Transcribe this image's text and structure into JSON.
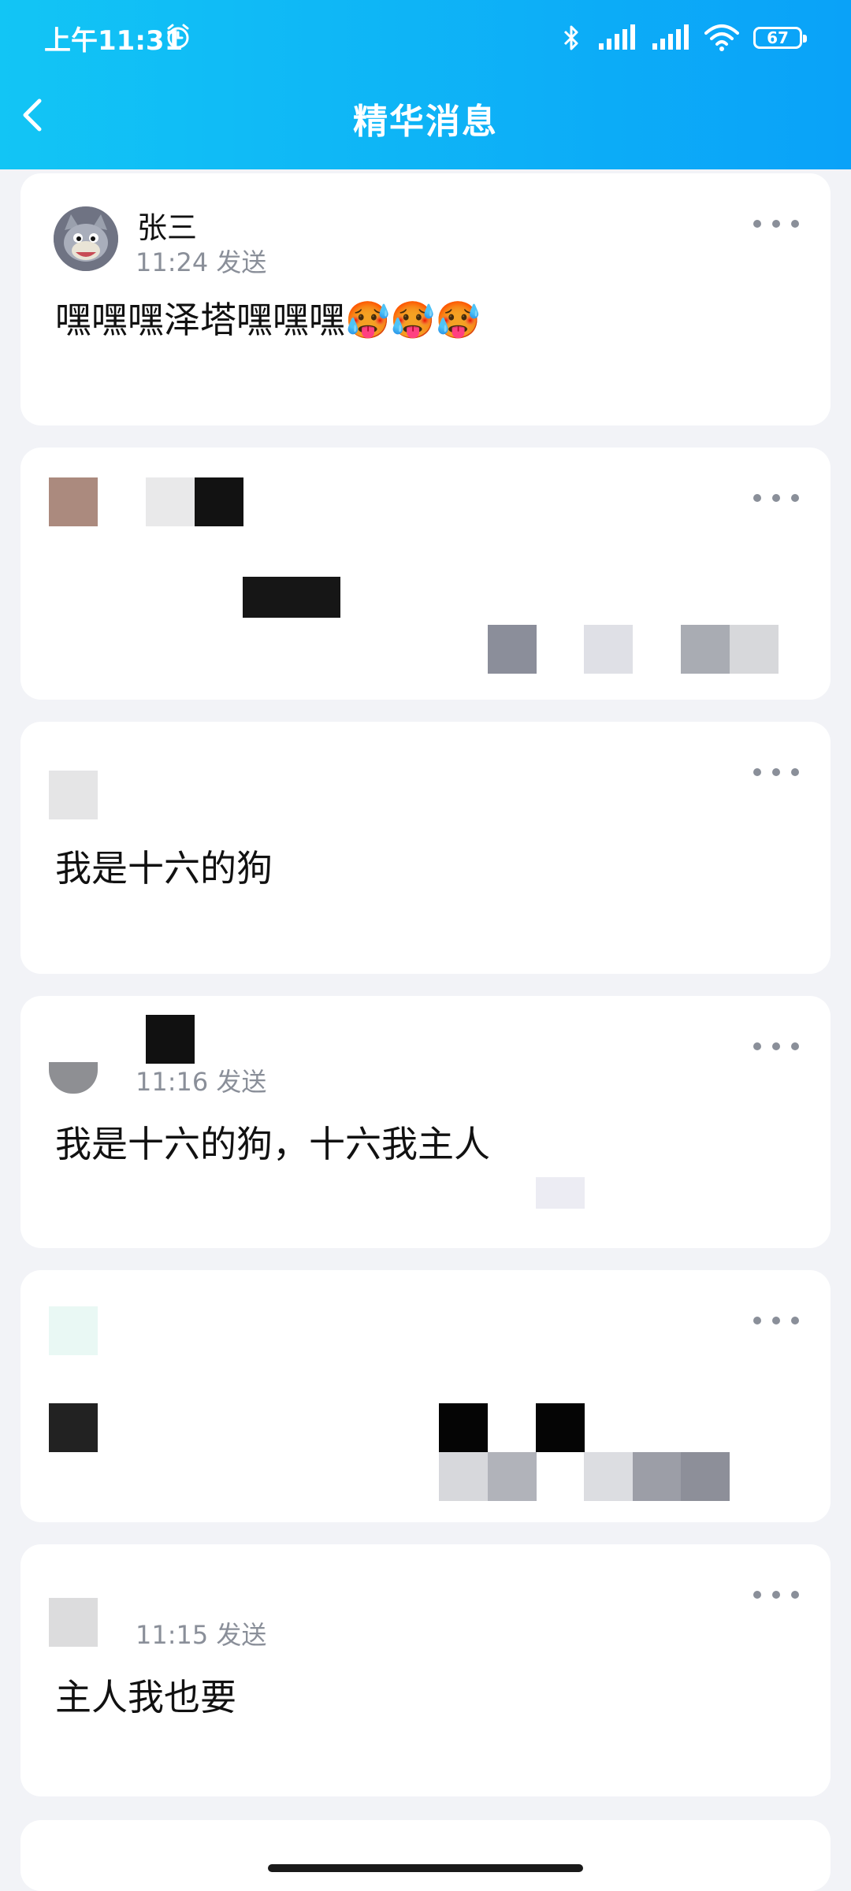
{
  "status_bar": {
    "time": "上午11:31",
    "battery": "67"
  },
  "header": {
    "title": "精华消息"
  },
  "messages": [
    {
      "sender": "张三",
      "time": "11:24 发送",
      "text": "嘿嘿嘿泽塔嘿嘿嘿🥵🥵🥵"
    },
    {
      "sender": "",
      "time": "",
      "text": ""
    },
    {
      "sender": "",
      "time": "",
      "text": "我是十六的狗"
    },
    {
      "sender": "",
      "time": "11:16 发送",
      "text": "我是十六的狗，十六我主人"
    },
    {
      "sender": "",
      "time": "",
      "text": ""
    },
    {
      "sender": "",
      "time": "11:15 发送",
      "text": "主人我也要"
    }
  ]
}
